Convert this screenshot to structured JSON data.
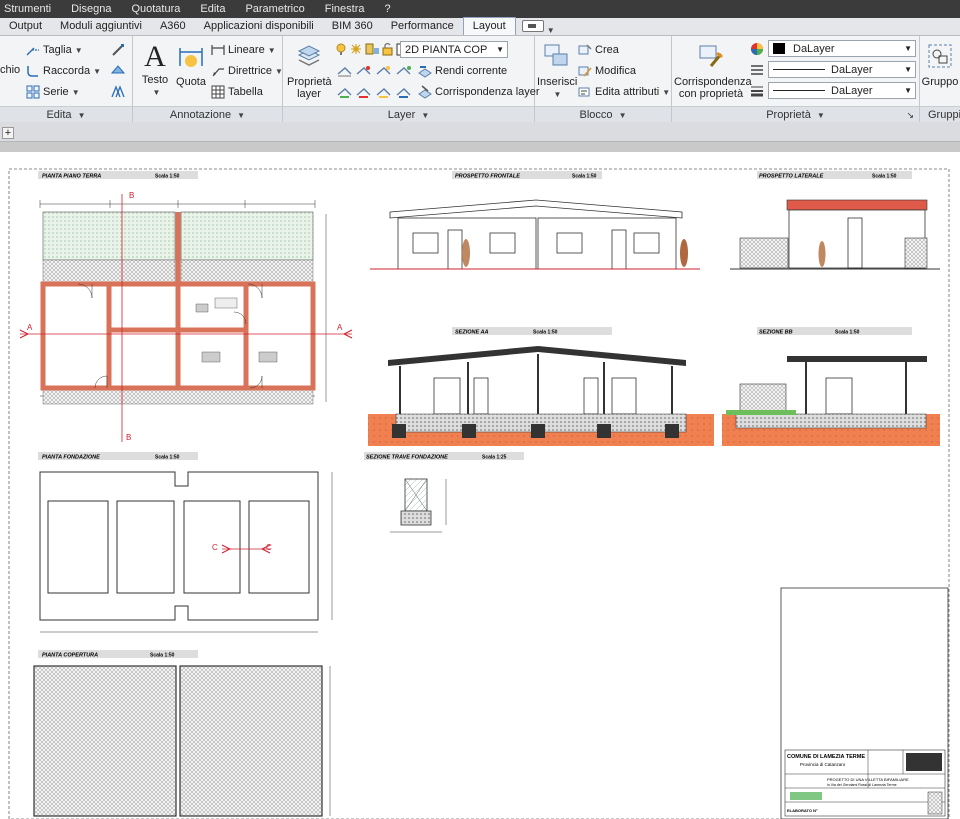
{
  "menu": [
    "Strumenti",
    "Disegna",
    "Quotatura",
    "Edita",
    "Parametrico",
    "Finestra",
    "?"
  ],
  "tabs": [
    "Output",
    "Moduli aggiuntivi",
    "A360",
    "Applicazioni disponibili",
    "BIM 360",
    "Performance",
    "Layout"
  ],
  "active_tab": "Layout",
  "ribbon": {
    "edit": {
      "title": "Edita",
      "left_label": "chio",
      "taglia": "Taglia",
      "raccorda": "Raccorda",
      "serie": "Serie"
    },
    "annotation": {
      "title": "Annotazione",
      "testo": "Testo",
      "quota": "Quota",
      "lineare": "Lineare",
      "direttrice": "Direttrice",
      "tabella": "Tabella"
    },
    "layer": {
      "title": "Layer",
      "proprieta_layer_1": "Proprietà",
      "proprieta_layer_2": "layer",
      "current_layer": "2D PIANTA COP",
      "rendi_corrente": "Rendi corrente",
      "corrispondenza_layer": "Corrispondenza layer"
    },
    "block": {
      "title": "Blocco",
      "inserisci": "Inserisci",
      "crea": "Crea",
      "modifica": "Modifica",
      "edita_attributi": "Edita attributi"
    },
    "properties": {
      "title": "Proprietà",
      "corrisp_1": "Corrispondenza",
      "corrisp_2": "con proprietà",
      "color": "DaLayer",
      "linetype": "DaLayer",
      "lineweight": "DaLayer"
    },
    "groups": {
      "title": "Gruppi",
      "gruppo": "Gruppo"
    }
  },
  "drawing": {
    "pianta_piano_terra": "PIANTA PIANO TERRA",
    "prospetto_frontale": "PROSPETTO FRONTALE",
    "prospetto_laterale": "PROSPETTO LATERALE",
    "sezione_aa": "SEZIONE AA",
    "sezione_bb": "SEZIONE BB",
    "pianta_fondazione": "PIANTA FONDAZIONE",
    "sezione_trave": "SEZIONE TRAVE FONDAZIONE",
    "pianta_copertura": "PIANTA COPERTURA",
    "scala_50": "Scala 1:50",
    "scala_25": "Scala 1:25",
    "marker_a": "A",
    "marker_b": "B",
    "marker_c": "C",
    "title_block": {
      "comune": "COMUNE DI LAMEZIA TERME",
      "provincia": "Provincia di Catanzaro",
      "progetto_1": "PROGETTO DI UNA VILLETTA BIFAMILIARE",
      "progetto_2": "in Via dei Gerolami Rossi di Lamezia Terme",
      "elaborato": "ELABORATO N°"
    }
  }
}
